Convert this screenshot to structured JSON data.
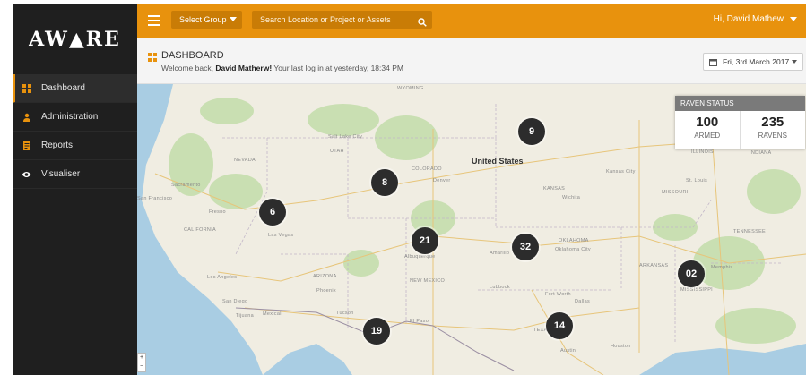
{
  "app": {
    "logo": "AW▲RE"
  },
  "sidebar": {
    "items": [
      {
        "label": "Dashboard",
        "icon": "dashboard-icon",
        "active": true
      },
      {
        "label": "Administration",
        "icon": "user-icon",
        "active": false
      },
      {
        "label": "Reports",
        "icon": "report-icon",
        "active": false
      },
      {
        "label": "Visualiser",
        "icon": "eye-icon",
        "active": false
      }
    ]
  },
  "topbar": {
    "select_group_label": "Select Group",
    "search_placeholder": "Search Location or Project or Assets",
    "user_greeting": "Hi, David Mathew"
  },
  "header": {
    "title": "DASHBOARD",
    "welcome_prefix": "Welcome back,",
    "welcome_name": "David Matherw!",
    "welcome_suffix": "Your last log in at yesterday, 18:34 PM",
    "date": "Fri, 3rd March 2017"
  },
  "raven_status": {
    "title": "RAVEN STATUS",
    "armed_value": "100",
    "armed_label": "ARMED",
    "ravens_value": "235",
    "ravens_label": "RAVENS"
  },
  "map": {
    "country": "United States",
    "labels": [
      "WYOMING",
      "NEVADA",
      "UTAH",
      "COLORADO",
      "KANSAS",
      "MISSOURI",
      "OKLAHOMA",
      "ARKANSAS",
      "MISSISSIPPI",
      "TENNESSEE",
      "ILLINOIS",
      "INDIANA",
      "CALIFORNIA",
      "ARIZONA",
      "NEW MEXICO",
      "TEXAS",
      "Las Vegas",
      "Los Angeles",
      "San Diego",
      "Phoenix",
      "Tucson",
      "Albuquerque",
      "El Paso",
      "Dallas",
      "Fort Worth",
      "Oklahoma City",
      "Wichita",
      "Denver",
      "Salt Lake City",
      "Kansas City",
      "St. Louis",
      "Memphis",
      "Austin",
      "Houston",
      "Amarillo",
      "Lubbock",
      "Tijuana",
      "Mexicali",
      "San Francisco",
      "Sacramento",
      "Fresno"
    ],
    "markers": [
      "9",
      "8",
      "6",
      "21",
      "32",
      "02",
      "19",
      "14"
    ],
    "zoom_in": "+",
    "zoom_out": "−"
  },
  "colors": {
    "accent": "#e8920d",
    "sidebar": "#1f1f1f",
    "marker": "#2c2c2c"
  }
}
